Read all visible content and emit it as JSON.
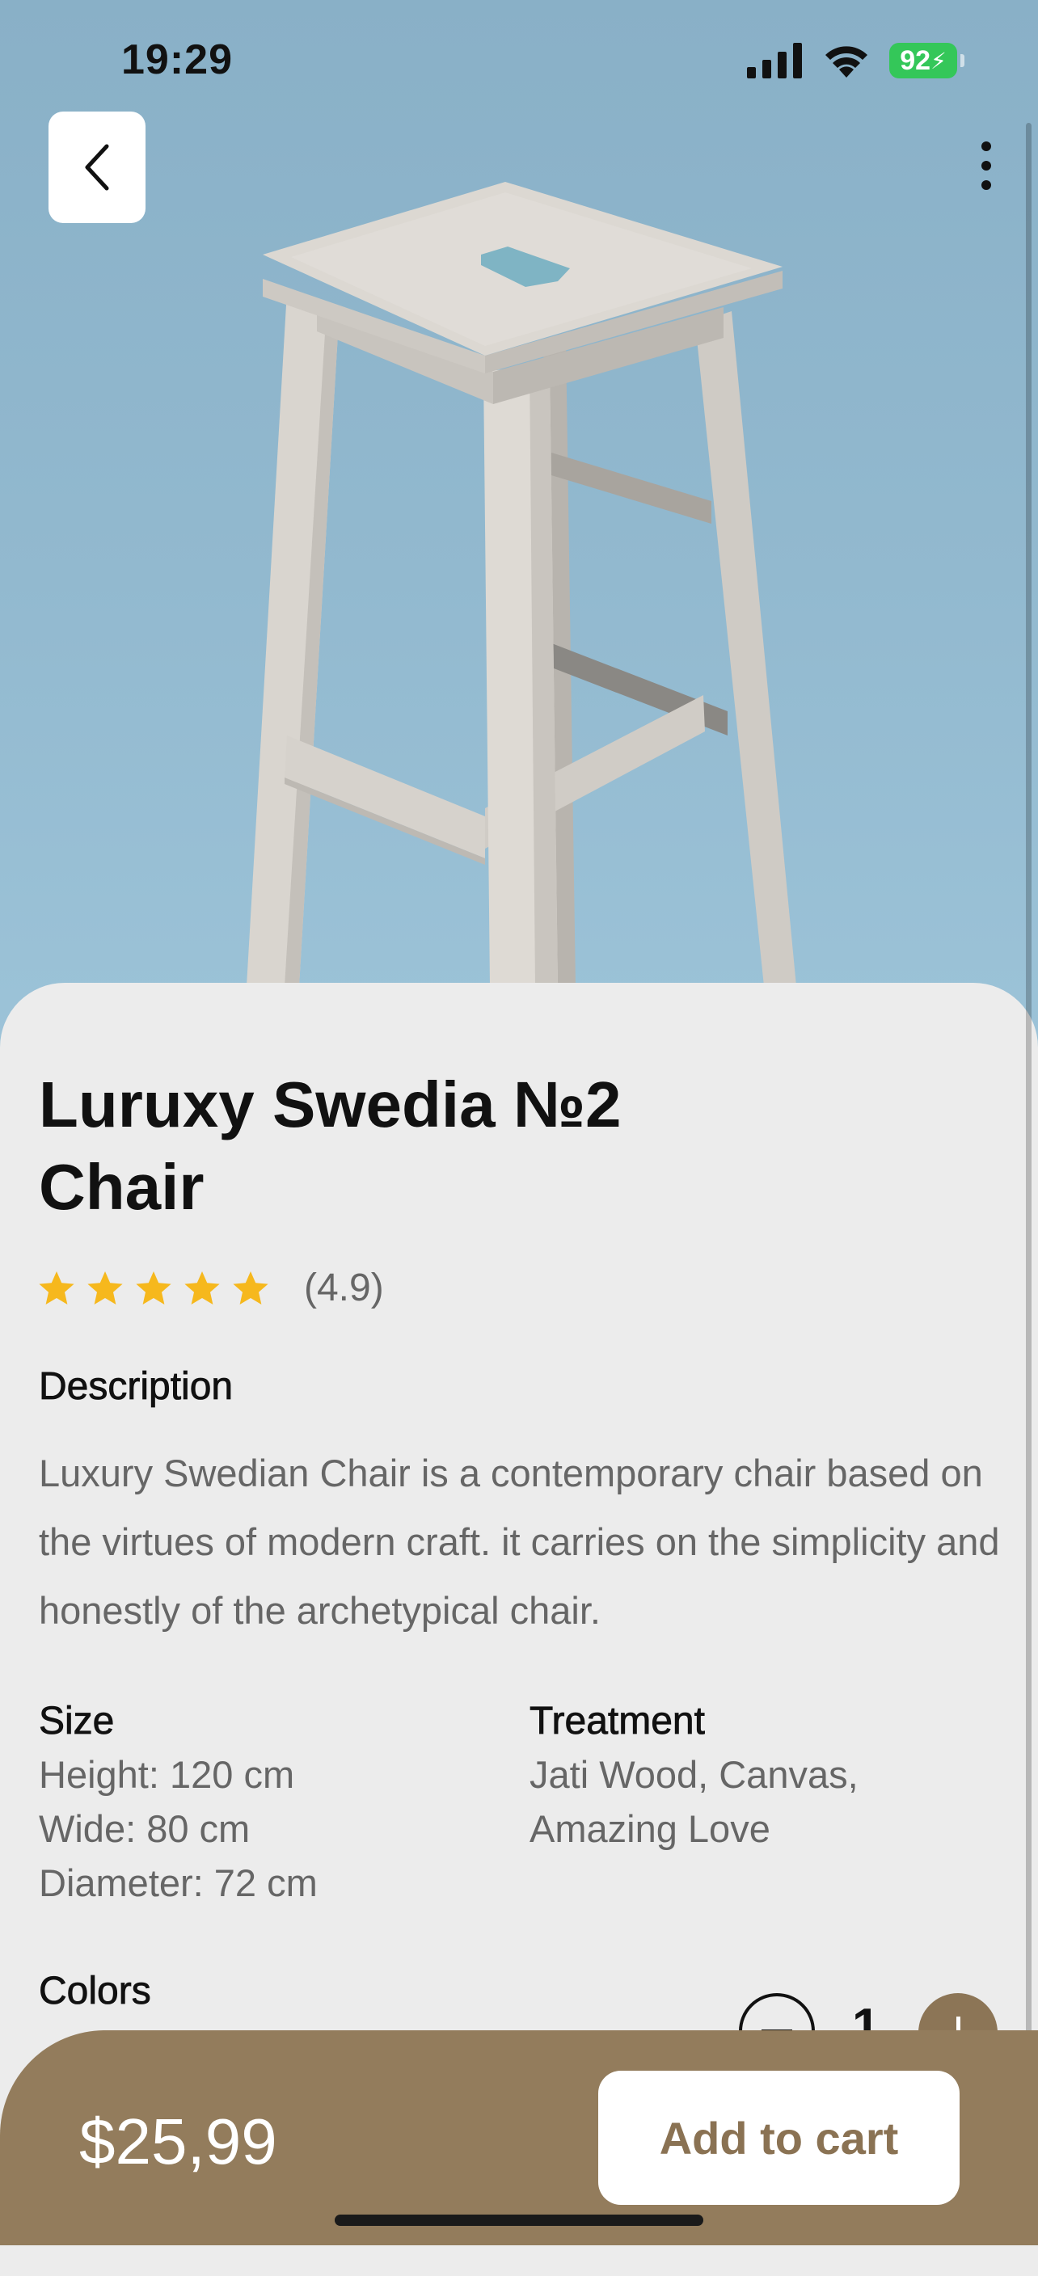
{
  "status_bar": {
    "time": "19:29",
    "battery": "92"
  },
  "product": {
    "title": "Luruxy Swedia №2 Chair",
    "rating_text": "(4.9)",
    "rating_value": 4.9,
    "rating_stars": 5
  },
  "description": {
    "heading": "Description",
    "text": "Luxury Swedian Chair is a contemporary chair based on the virtues of modern craft. it carries on the simplicity and honestly of the archetypical chair."
  },
  "size": {
    "heading": "Size",
    "lines": [
      "Height: 120 cm",
      "Wide: 80 cm",
      "Diameter: 72 cm"
    ]
  },
  "treatment": {
    "heading": "Treatment",
    "lines": [
      "Jati Wood, Canvas,",
      "Amazing Love"
    ]
  },
  "colors": {
    "heading": "Colors"
  },
  "quantity": {
    "value": "1"
  },
  "footer": {
    "price": "$25,99",
    "add_to_cart": "Add to cart"
  },
  "icons": {
    "back": "chevron-left-icon",
    "more": "more-vertical-icon",
    "signal": "cellular-signal-icon",
    "wifi": "wifi-icon",
    "battery": "battery-charging-icon",
    "star": "star-icon"
  },
  "colors_theme": {
    "accent_brown": "#937c5c",
    "star_yellow": "#f6b81d",
    "battery_green": "#34c759",
    "hero_blue": "#8fb6cc"
  }
}
